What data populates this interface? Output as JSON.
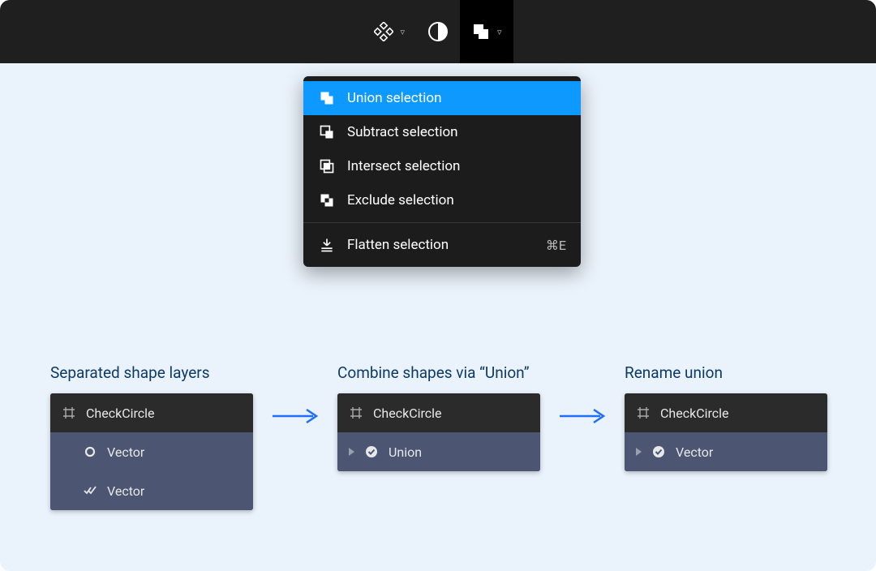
{
  "toolbar": {
    "tool1": "components",
    "tool2": "contrast",
    "tool3": "boolean-union"
  },
  "dropdown": {
    "items": [
      {
        "label": "Union selection",
        "icon": "union",
        "selected": true
      },
      {
        "label": "Subtract selection",
        "icon": "subtract",
        "selected": false
      },
      {
        "label": "Intersect selection",
        "icon": "intersect",
        "selected": false
      },
      {
        "label": "Exclude selection",
        "icon": "exclude",
        "selected": false
      }
    ],
    "flatten": {
      "label": "Flatten selection",
      "shortcut": "⌘E"
    }
  },
  "panels": {
    "p1": {
      "title": "Separated shape layers",
      "header": "CheckCircle",
      "rows": [
        {
          "icon": "circle-outline",
          "label": "Vector"
        },
        {
          "icon": "double-check",
          "label": "Vector"
        }
      ]
    },
    "p2": {
      "title": "Combine shapes via “Union”",
      "header": "CheckCircle",
      "rows": [
        {
          "icon": "check-circle-fill",
          "label": "Union",
          "caret": true
        }
      ]
    },
    "p3": {
      "title": "Rename union",
      "header": "CheckCircle",
      "rows": [
        {
          "icon": "check-circle-fill",
          "label": "Vector",
          "caret": true
        }
      ]
    }
  }
}
